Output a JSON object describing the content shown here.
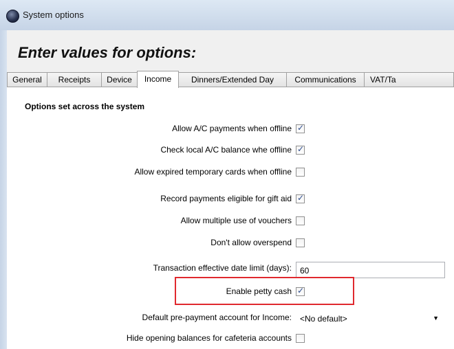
{
  "window": {
    "title": "System options"
  },
  "heading": "Enter values for options:",
  "tabs": [
    {
      "label": "General",
      "active": false
    },
    {
      "label": "Receipts",
      "active": false
    },
    {
      "label": "Device",
      "active": false
    },
    {
      "label": "Income",
      "active": true
    },
    {
      "label": "Dinners/Extended Day",
      "active": false
    },
    {
      "label": "Communications",
      "active": false
    },
    {
      "label": "VAT/Ta",
      "active": false
    }
  ],
  "section_title": "Options set across the system",
  "options": [
    {
      "label": "Allow A/C payments when offline",
      "checked": true
    },
    {
      "label": "Check local A/C balance whe offline",
      "checked": true
    },
    {
      "label": "Allow expired temporary cards when offline",
      "checked": false
    },
    {
      "label": "Record payments eligible for gift aid",
      "checked": true
    },
    {
      "label": "Allow multiple use of vouchers",
      "checked": false
    },
    {
      "label": "Don't allow overspend",
      "checked": false
    }
  ],
  "date_limit": {
    "label": "Transaction effective date limit (days):",
    "value": "60"
  },
  "petty_cash": {
    "label": "Enable petty cash",
    "checked": true
  },
  "default_account": {
    "label": "Default pre-payment account for Income:",
    "value": "<No default>"
  },
  "hide_balances": {
    "label": "Hide opening balances for cafeteria accounts",
    "checked": false
  },
  "colors": {
    "highlight": "#e0282e",
    "check": "#2e4d8e"
  }
}
